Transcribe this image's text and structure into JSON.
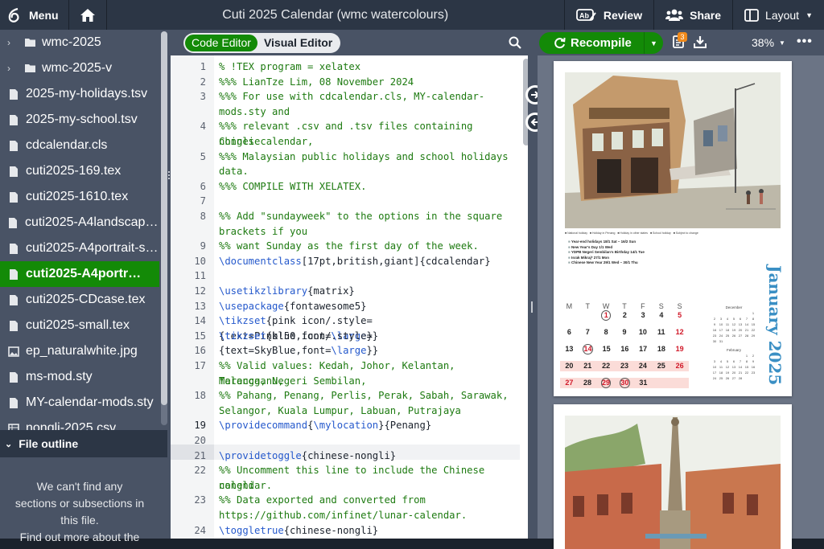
{
  "topbar": {
    "menu_label": "Menu",
    "title": "Cuti 2025 Calendar (wmc watercolours)",
    "review_label": "Review",
    "share_label": "Share",
    "layout_label": "Layout"
  },
  "filetree": {
    "items": [
      {
        "label": "wmc-2025",
        "type": "folder"
      },
      {
        "label": "wmc-2025-v",
        "type": "folder"
      },
      {
        "label": "2025-my-holidays.tsv",
        "type": "file"
      },
      {
        "label": "2025-my-school.tsv",
        "type": "file"
      },
      {
        "label": "cdcalendar.cls",
        "type": "file"
      },
      {
        "label": "cuti2025-169.tex",
        "type": "file"
      },
      {
        "label": "cuti2025-1610.tex",
        "type": "file"
      },
      {
        "label": "cuti2025-A4landscape…",
        "type": "file"
      },
      {
        "label": "cuti2025-A4portrait-s…",
        "type": "file"
      },
      {
        "label": "cuti2025-A4portr…",
        "type": "file",
        "selected": true
      },
      {
        "label": "cuti2025-CDcase.tex",
        "type": "file"
      },
      {
        "label": "cuti2025-small.tex",
        "type": "file"
      },
      {
        "label": "ep_naturalwhite.jpg",
        "type": "image"
      },
      {
        "label": "ms-mod.sty",
        "type": "file"
      },
      {
        "label": "MY-calendar-mods.sty",
        "type": "file"
      },
      {
        "label": "nongli-2025.csv",
        "type": "table"
      }
    ]
  },
  "outline": {
    "header": "File outline",
    "message_line1": "We can't find any",
    "message_line2": "sections or subsections in",
    "message_line3": "this file.",
    "link": "Find out more about the"
  },
  "editor": {
    "code_editor_label": "Code Editor",
    "visual_editor_label": "Visual Editor",
    "lines": [
      {
        "n": "1",
        "rows": [
          "% !TEX program = xelatex"
        ]
      },
      {
        "n": "2",
        "rows": [
          "%%% LianTze Lim, 08 November 2024"
        ]
      },
      {
        "n": "3",
        "rows": [
          "%%% For use with cdcalendar.cls, MY-calendar-",
          "mods.sty and"
        ]
      },
      {
        "n": "4",
        "rows": [
          "%%% relevant .csv and .tsv files containing Chinese",
          "nongli calendar,"
        ]
      },
      {
        "n": "5",
        "rows": [
          "%%% Malaysian public holidays and school holidays",
          "data."
        ]
      },
      {
        "n": "6",
        "rows": [
          "%%% COMPILE WITH XELATEX."
        ]
      },
      {
        "n": "7",
        "rows": [
          ""
        ]
      },
      {
        "n": "8",
        "rows": [
          "%% Add \"sundayweek\" to the options in the square",
          "brackets if you"
        ]
      },
      {
        "n": "9",
        "rows": [
          "%% want Sunday as the first day of the week."
        ]
      },
      {
        "n": "10",
        "rows": [
          "\\documentclass[17pt,british,giant]{cdcalendar}"
        ]
      },
      {
        "n": "11",
        "rows": [
          ""
        ]
      },
      {
        "n": "12",
        "rows": [
          "\\usetikzlibrary{matrix}"
        ]
      },
      {
        "n": "13",
        "rows": [
          "\\usepackage{fontawesome5}"
        ]
      },
      {
        "n": "14",
        "rows": [
          "\\tikzset{pink icon/.style={text=Pink!50,font=\\large}}"
        ]
      },
      {
        "n": "15",
        "rows": [
          "\\tikzset{blue icon/.style={text=SkyBlue,font=\\large}}"
        ]
      },
      {
        "n": "16",
        "rows": [
          ""
        ]
      },
      {
        "n": "17",
        "rows": [
          "%% Valid values: Kedah, Johor, Kelantan, Terengganu,",
          "Malacca, Negeri Sembilan,"
        ]
      },
      {
        "n": "18",
        "rows": [
          "%% Pahang, Penang, Perlis, Perak, Sabah, Sarawak,",
          "Selangor, Kuala Lumpur, Labuan, Putrajaya"
        ]
      },
      {
        "n": "19",
        "rows": [
          "\\providecommand{\\mylocation}{Penang}"
        ]
      },
      {
        "n": "20",
        "rows": [
          ""
        ]
      },
      {
        "n": "21",
        "rows": [
          "\\providetoggle{chinese-nongli}"
        ]
      },
      {
        "n": "22",
        "rows": [
          "%% Uncomment this line to include the Chinese nongli",
          "calendar."
        ]
      },
      {
        "n": "23",
        "rows": [
          "%% Data exported and converted from",
          "https://github.com/infinet/lunar-calendar."
        ]
      },
      {
        "n": "24",
        "rows": [
          "\\toggletrue{chinese-nongli}"
        ]
      }
    ]
  },
  "pdf": {
    "recompile_label": "Recompile",
    "logs_badge": "3",
    "zoom": "38%",
    "month_title": "January 2025",
    "holidays": [
      "Year-end holidays   18/1 Sat – 16/2 Sun",
      "New Year's Day   1/1 Wed",
      "YDPB Negeri Sembilan's Birthday   14/1 Tue",
      "Israk Mikraj*   27/1 Mon",
      "Chinese New Year   29/1 Wed – 30/1 Thu"
    ],
    "weekdays": [
      "M",
      "T",
      "W",
      "T",
      "F",
      "S",
      "S"
    ],
    "weeks": [
      [
        "",
        "",
        "1",
        "2",
        "3",
        "4",
        "5"
      ],
      [
        "6",
        "7",
        "8",
        "9",
        "10",
        "11",
        "12"
      ],
      [
        "13",
        "14",
        "15",
        "16",
        "17",
        "18",
        "19"
      ],
      [
        "20",
        "21",
        "22",
        "23",
        "24",
        "25",
        "26"
      ],
      [
        "27",
        "28",
        "29",
        "30",
        "31",
        "",
        ""
      ]
    ],
    "mini_months": [
      "December",
      "February"
    ]
  },
  "colors": {
    "green": "#138a07",
    "topbar": "#2c3645",
    "sidebar": "#495365",
    "comment": "#1d7a10",
    "keyword": "#2559cc",
    "month_blue": "#3a8fc4"
  }
}
